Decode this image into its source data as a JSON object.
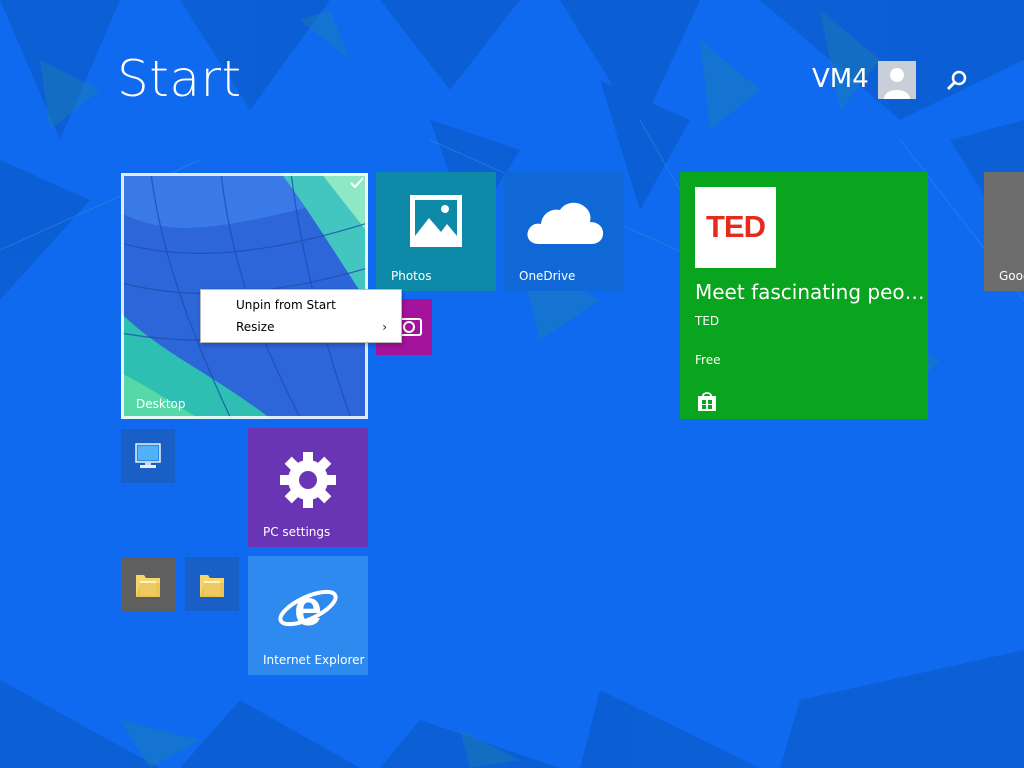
{
  "header": {
    "title": "Start",
    "user_name": "VM4"
  },
  "tiles": {
    "desktop": {
      "label": "Desktop",
      "color": "#1f6fe0"
    },
    "photos": {
      "label": "Photos",
      "color": "#0e8aa8"
    },
    "onedrive": {
      "label": "OneDrive",
      "color": "#1068d6"
    },
    "camera": {
      "color": "#a4139b"
    },
    "ted": {
      "logo": "TED",
      "headline": "Meet fascinating peo…",
      "publisher": "TED",
      "price": "Free",
      "color": "#0aa51e"
    },
    "google": {
      "label": "Goog"
    },
    "pc_settings": {
      "label": "PC settings",
      "color": "#6a35b5"
    },
    "internet_explorer": {
      "label": "Internet Explorer",
      "color": "#2f8af0"
    }
  },
  "context_menu": {
    "items": [
      {
        "label": "Unpin from Start",
        "has_submenu": false
      },
      {
        "label": "Resize",
        "has_submenu": true,
        "arrow": "›"
      }
    ]
  },
  "icons": {
    "avatar": "user-avatar-icon",
    "search": "search-icon",
    "store": "store-icon"
  }
}
